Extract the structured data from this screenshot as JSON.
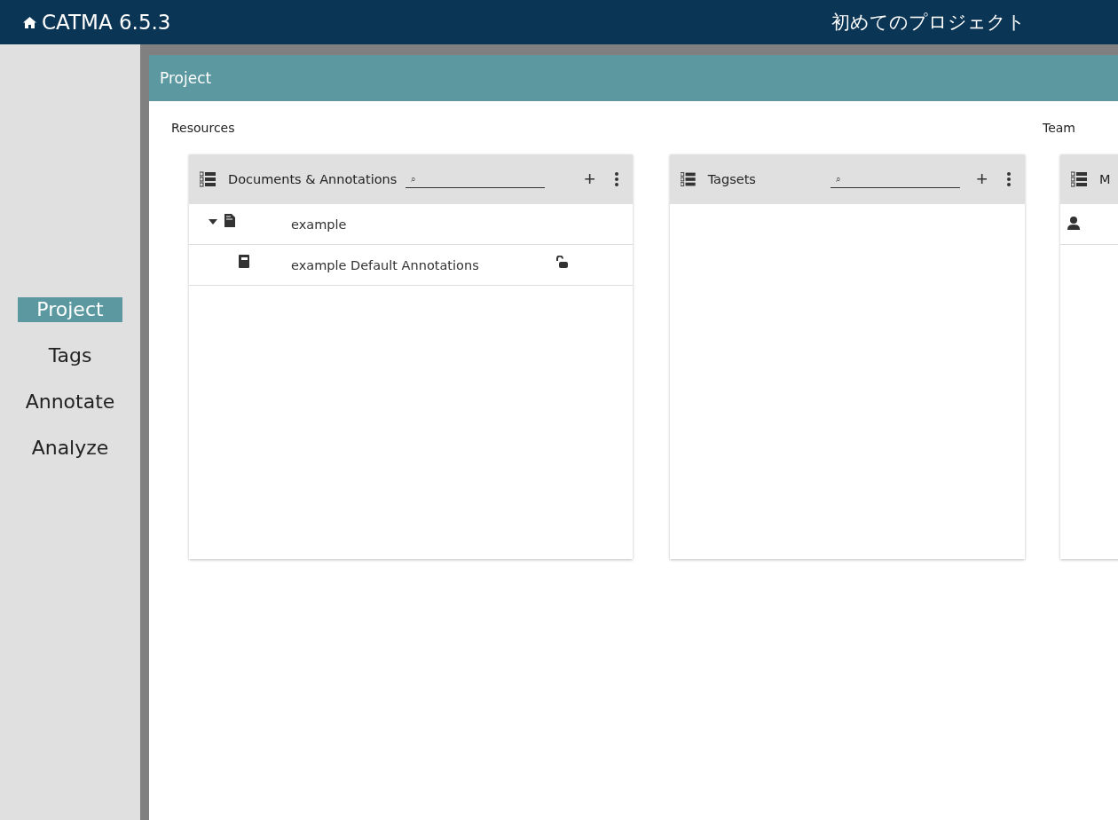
{
  "app_bar": {
    "title": "CATMA 6.5.3",
    "project_name": "初めてのプロジェクト"
  },
  "nav": [
    {
      "label": "Project",
      "selected": true
    },
    {
      "label": "Tags",
      "selected": false
    },
    {
      "label": "Annotate",
      "selected": false
    },
    {
      "label": "Analyze",
      "selected": false
    }
  ],
  "page_title": "Project",
  "sections": [
    {
      "heading": "Resources",
      "cards": [
        {
          "title": "Documents & Annotations",
          "search": {
            "placeholder": "⌕"
          },
          "add_label": "+",
          "rows": [
            {
              "kind": "document",
              "label": "example",
              "expanded": true,
              "children": [
                {
                  "kind": "collection",
                  "label": "example Default Annotations",
                  "locked": false
                }
              ]
            }
          ]
        },
        {
          "title": "Tagsets",
          "search": {
            "placeholder": "⌕"
          },
          "add_label": "+"
        }
      ]
    },
    {
      "heading": "Team",
      "cards": [
        {
          "title": "M",
          "rows": [
            {
              "kind": "member"
            }
          ]
        }
      ]
    }
  ]
}
